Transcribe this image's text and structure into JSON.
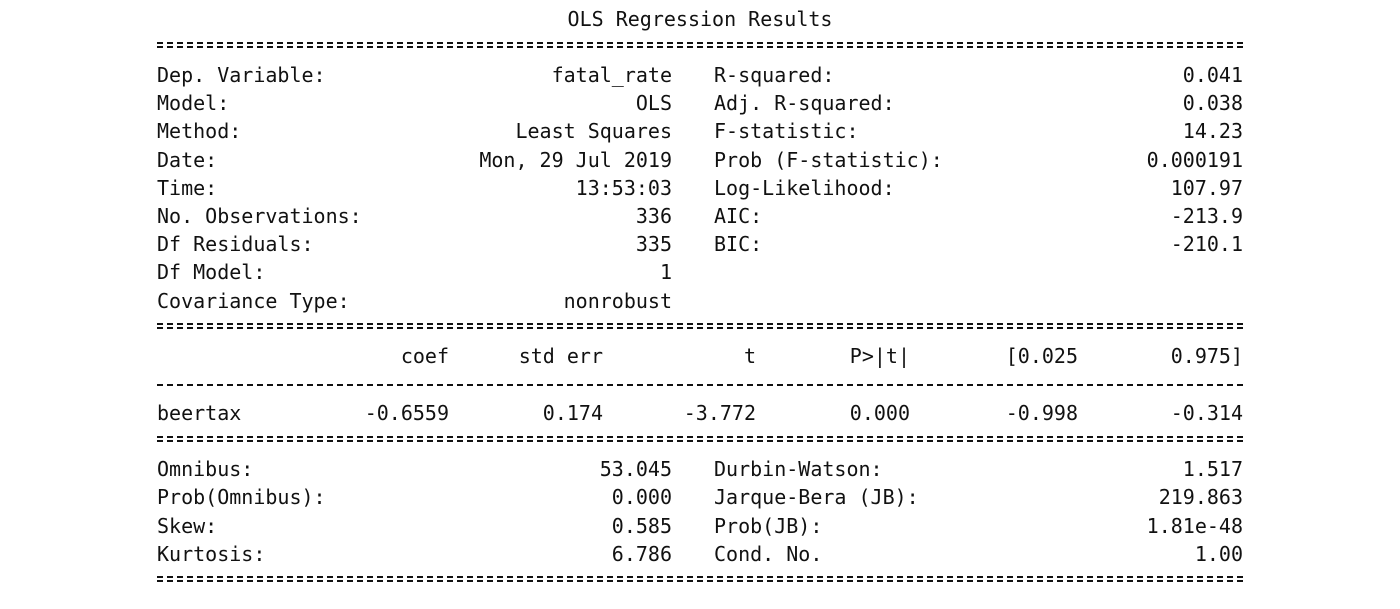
{
  "title": "OLS Regression Results",
  "summary": {
    "left": [
      {
        "label": "Dep. Variable:",
        "value": "fatal_rate"
      },
      {
        "label": "Model:",
        "value": "OLS"
      },
      {
        "label": "Method:",
        "value": "Least Squares"
      },
      {
        "label": "Date:",
        "value": "Mon, 29 Jul 2019"
      },
      {
        "label": "Time:",
        "value": "13:53:03"
      },
      {
        "label": "No. Observations:",
        "value": "336"
      },
      {
        "label": "Df Residuals:",
        "value": "335"
      },
      {
        "label": "Df Model:",
        "value": "1"
      },
      {
        "label": "Covariance Type:",
        "value": "nonrobust"
      }
    ],
    "right": [
      {
        "label": "R-squared:",
        "value": "0.041"
      },
      {
        "label": "Adj. R-squared:",
        "value": "0.038"
      },
      {
        "label": "F-statistic:",
        "value": "14.23"
      },
      {
        "label": "Prob (F-statistic):",
        "value": "0.000191"
      },
      {
        "label": "Log-Likelihood:",
        "value": "107.97"
      },
      {
        "label": "AIC:",
        "value": "-213.9"
      },
      {
        "label": "BIC:",
        "value": "-210.1"
      }
    ]
  },
  "coef_table": {
    "headers": [
      "coef",
      "std err",
      "t",
      "P>|t|",
      "[0.025",
      "0.975]"
    ],
    "rows": [
      {
        "name": "beertax",
        "values": [
          "-0.6559",
          "0.174",
          "-3.772",
          "0.000",
          "-0.998",
          "-0.314"
        ]
      }
    ]
  },
  "diagnostics": {
    "left": [
      {
        "label": "Omnibus:",
        "value": "53.045"
      },
      {
        "label": "Prob(Omnibus):",
        "value": "0.000"
      },
      {
        "label": "Skew:",
        "value": "0.585"
      },
      {
        "label": "Kurtosis:",
        "value": "6.786"
      }
    ],
    "right": [
      {
        "label": "Durbin-Watson:",
        "value": "1.517"
      },
      {
        "label": "Jarque-Bera (JB):",
        "value": "219.863"
      },
      {
        "label": "Prob(JB):",
        "value": "1.81e-48"
      },
      {
        "label": "Cond. No.",
        "value": "1.00"
      }
    ]
  }
}
